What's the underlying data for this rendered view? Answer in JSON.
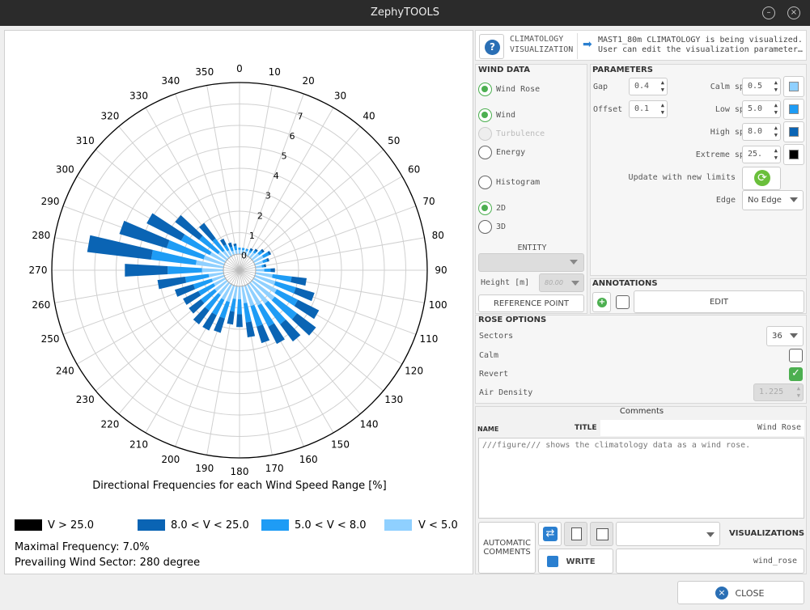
{
  "window": {
    "title": "ZephyTOOLS",
    "minimize_icon": "minimize-icon",
    "close_icon": "close-circle-icon"
  },
  "header": {
    "title_line1": "CLIMATOLOGY",
    "title_line2": "VISUALIZATION",
    "info_line1": "MAST1_80m CLIMATOLOGY is being visualized.",
    "info_line2": "User can edit the visualization parameter…",
    "help_icon": "help-icon",
    "arrow_icon": "arrow-right-icon"
  },
  "wind_data": {
    "title": "WIND DATA",
    "options": [
      {
        "label": "Wind Rose",
        "state": "on"
      },
      {
        "label": "Wind",
        "state": "on"
      },
      {
        "label": "Turbulence",
        "state": "disabled"
      },
      {
        "label": "Energy",
        "state": "off"
      },
      {
        "label": "Histogram",
        "state": "off"
      },
      {
        "label": "2D",
        "state": "on"
      },
      {
        "label": "3D",
        "state": "off"
      }
    ],
    "entity_label": "ENTITY",
    "entity_value": "",
    "height_label": "Height [m]",
    "height_value": "80.00",
    "reference_point": "REFERENCE POINT"
  },
  "parameters": {
    "title": "PARAMETERS",
    "gap_label": "Gap",
    "gap_value": "0.4",
    "offset_label": "Offset",
    "offset_value": "0.1",
    "speeds": [
      {
        "label": "Calm speed",
        "value": "0.5",
        "color": "#8fd0ff"
      },
      {
        "label": "Low speed",
        "value": "5.0",
        "color": "#1e9cf5"
      },
      {
        "label": "High speed",
        "value": "8.0",
        "color": "#0a64b4"
      },
      {
        "label": "Extreme speed",
        "value": "25.",
        "color": "#000000"
      }
    ],
    "update_label": "Update with new limits",
    "refresh_icon": "refresh-icon",
    "edge_label": "Edge",
    "edge_value": "No Edge"
  },
  "annotations": {
    "title": "ANNOTATIONS",
    "edit_label": "EDIT",
    "add_icon": "add-icon"
  },
  "rose_options": {
    "title": "ROSE OPTIONS",
    "sectors_label": "Sectors",
    "sectors_value": "36",
    "calm_label": "Calm",
    "calm_checked": false,
    "revert_label": "Revert",
    "revert_checked": true,
    "air_density_label": "Air Density",
    "air_density_value": "1.225"
  },
  "comments": {
    "title": "Comments",
    "name_label": "NAME",
    "title_label": "TITLE",
    "title_value": "Wind Rose",
    "body": "///figure/// shows the climatology data as a wind rose."
  },
  "bottom": {
    "automatic_comments_line1": "AUTOMATIC",
    "automatic_comments_line2": "COMMENTS",
    "write_label": "WRITE",
    "visualizations_label": "VISUALIZATIONS",
    "visualization_name": "wind_rose",
    "visualizations_value": ""
  },
  "close_label": "CLOSE",
  "close_icon": "close-icon",
  "chart_data": {
    "type": "wind_rose",
    "xlabel": "Directional Frequencies for each Wind Speed Range [%]",
    "direction_ticks": [
      0,
      10,
      20,
      30,
      40,
      50,
      60,
      70,
      80,
      90,
      100,
      110,
      120,
      130,
      140,
      150,
      160,
      170,
      180,
      190,
      200,
      210,
      220,
      230,
      240,
      250,
      260,
      270,
      280,
      290,
      300,
      310,
      320,
      330,
      340,
      350
    ],
    "radial_ticks": [
      0,
      1,
      2,
      3,
      4,
      5,
      6,
      7
    ],
    "rlim": [
      0,
      8
    ],
    "legend": [
      {
        "label": "V > 25.0",
        "color": "#000000"
      },
      {
        "label": "8.0 < V < 25.0",
        "color": "#0a64b4"
      },
      {
        "label": "5.0 < V < 8.0",
        "color": "#1e9cf5"
      },
      {
        "label": "V < 5.0",
        "color": "#8fd0ff"
      }
    ],
    "stack_order": [
      "V < 5.0",
      "5.0 < V < 8.0",
      "8.0 < V < 25.0"
    ],
    "colors": [
      "#8fd0ff",
      "#1e9cf5",
      "#0a64b4"
    ],
    "sectors": [
      {
        "dir": 0,
        "v": [
          0.2,
          0.1,
          0.0
        ]
      },
      {
        "dir": 10,
        "v": [
          0.2,
          0.1,
          0.0
        ]
      },
      {
        "dir": 20,
        "v": [
          0.2,
          0.1,
          0.0
        ]
      },
      {
        "dir": 30,
        "v": [
          0.2,
          0.1,
          0.1
        ]
      },
      {
        "dir": 40,
        "v": [
          0.3,
          0.1,
          0.1
        ]
      },
      {
        "dir": 50,
        "v": [
          0.4,
          0.2,
          0.1
        ]
      },
      {
        "dir": 60,
        "v": [
          0.5,
          0.3,
          0.1
        ]
      },
      {
        "dir": 70,
        "v": [
          0.4,
          0.2,
          0.1
        ]
      },
      {
        "dir": 80,
        "v": [
          0.3,
          0.1,
          0.1
        ]
      },
      {
        "dir": 90,
        "v": [
          0.4,
          0.3,
          0.2
        ]
      },
      {
        "dir": 100,
        "v": [
          0.8,
          0.9,
          0.7
        ]
      },
      {
        "dir": 110,
        "v": [
          1.0,
          1.0,
          0.9
        ]
      },
      {
        "dir": 120,
        "v": [
          1.2,
          1.1,
          1.1
        ]
      },
      {
        "dir": 130,
        "v": [
          1.3,
          1.3,
          1.1
        ]
      },
      {
        "dir": 140,
        "v": [
          1.2,
          1.2,
          1.0
        ]
      },
      {
        "dir": 150,
        "v": [
          1.1,
          1.1,
          0.9
        ]
      },
      {
        "dir": 160,
        "v": [
          1.0,
          1.0,
          0.8
        ]
      },
      {
        "dir": 170,
        "v": [
          0.8,
          0.9,
          0.7
        ]
      },
      {
        "dir": 180,
        "v": [
          0.6,
          0.7,
          0.6
        ]
      },
      {
        "dir": 190,
        "v": [
          0.6,
          0.6,
          0.6
        ]
      },
      {
        "dir": 200,
        "v": [
          0.8,
          0.8,
          0.7
        ]
      },
      {
        "dir": 210,
        "v": [
          0.8,
          0.8,
          0.8
        ]
      },
      {
        "dir": 220,
        "v": [
          0.7,
          0.9,
          0.8
        ]
      },
      {
        "dir": 230,
        "v": [
          0.7,
          0.8,
          0.7
        ]
      },
      {
        "dir": 240,
        "v": [
          0.6,
          0.8,
          0.8
        ]
      },
      {
        "dir": 250,
        "v": [
          0.6,
          0.9,
          0.9
        ]
      },
      {
        "dir": 260,
        "v": [
          0.7,
          1.1,
          1.3
        ]
      },
      {
        "dir": 270,
        "v": [
          1.0,
          1.6,
          2.0
        ]
      },
      {
        "dir": 280,
        "v": [
          1.3,
          2.1,
          3.0
        ]
      },
      {
        "dir": 290,
        "v": [
          1.0,
          1.8,
          2.3
        ]
      },
      {
        "dir": 300,
        "v": [
          0.8,
          1.5,
          1.8
        ]
      },
      {
        "dir": 310,
        "v": [
          0.5,
          1.1,
          1.4
        ]
      },
      {
        "dir": 320,
        "v": [
          0.4,
          0.7,
          0.9
        ]
      },
      {
        "dir": 330,
        "v": [
          0.3,
          0.3,
          0.3
        ]
      },
      {
        "dir": 340,
        "v": [
          0.2,
          0.2,
          0.2
        ]
      },
      {
        "dir": 350,
        "v": [
          0.2,
          0.2,
          0.1
        ]
      }
    ],
    "max_frequency_text": "Maximal Frequency: 7.0%",
    "prevailing_text": "Prevailing Wind Sector: 280 degree"
  }
}
